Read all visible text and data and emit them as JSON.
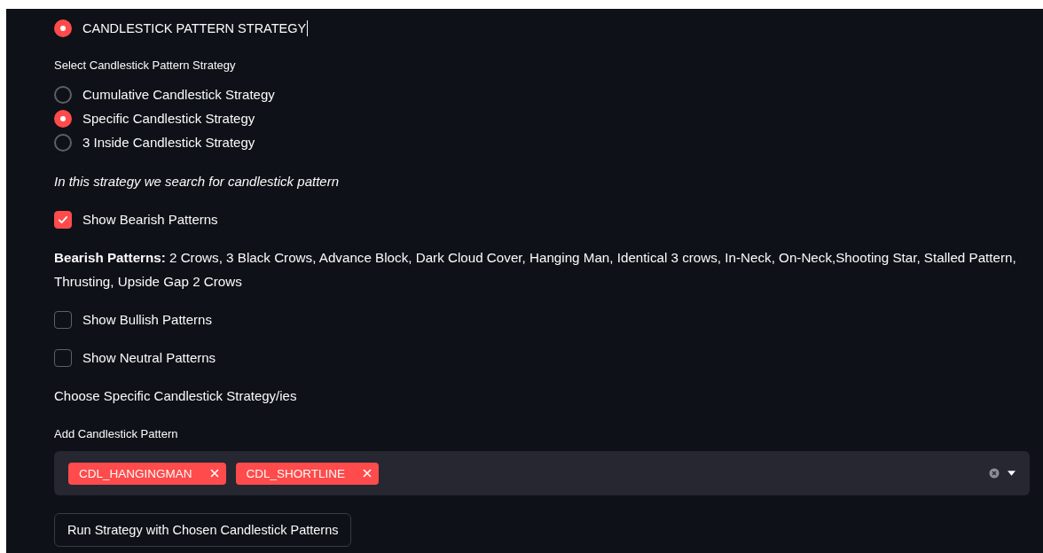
{
  "strategy_type": {
    "options": [
      {
        "label": "CANDLESTICK PATTERN STRATEGY",
        "selected": true
      }
    ]
  },
  "candlestick_strategy": {
    "label": "Select Candlestick Pattern Strategy",
    "options": [
      {
        "label": "Cumulative Candlestick Strategy",
        "selected": false
      },
      {
        "label": "Specific Candlestick Strategy",
        "selected": true
      },
      {
        "label": "3 Inside Candlestick Strategy",
        "selected": false
      }
    ]
  },
  "description": "In this strategy we search for candlestick pattern",
  "filters": [
    {
      "label": "Show Bearish Patterns",
      "checked": true,
      "details": "**Bearish Patterns:** 2 Crows, 3 Black Crows, Advance Block, Dark Cloud Cover, Hanging Man, Identical 3 crows, In-Neck, On-Neck,Shooting Star, Stalled Pattern, Thrusting, Upside Gap 2 Crows"
    },
    {
      "label": "Show Bullish Patterns",
      "checked": false
    },
    {
      "label": "Show Neutral Patterns",
      "checked": false
    }
  ],
  "choose_heading": "Choose Specific Candlestick Strategy/ies",
  "pattern_select": {
    "label": "Add Candlestick Pattern",
    "tags": [
      "CDL_HANGINGMAN",
      "CDL_SHORTLINE"
    ]
  },
  "run_button": "Run Strategy with Chosen Candlestick Patterns"
}
